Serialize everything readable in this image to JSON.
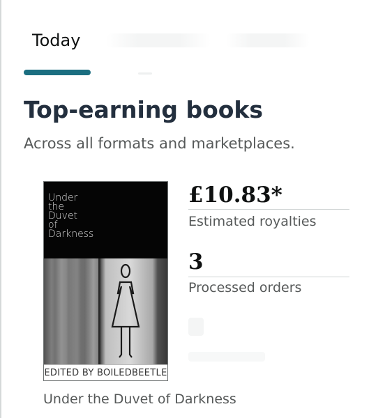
{
  "tabs": {
    "today_label": "Today"
  },
  "section": {
    "title": "Top-earning books",
    "subtitle": "Across all formats and marketplaces."
  },
  "book": {
    "cover_title": "Under\nthe\nDuvet\nof\nDarkness",
    "cover_band": "EDITED BY BOILEDBEETLE",
    "name": "Under the Duvet of Darkness"
  },
  "metrics": {
    "royalties_value": "£10.83*",
    "royalties_label": "Estimated royalties",
    "orders_value": "3",
    "orders_label": "Processed orders"
  },
  "colors": {
    "tab_indicator": "#1b6e80",
    "title_text": "#232f3e",
    "secondary_text": "#565959"
  }
}
